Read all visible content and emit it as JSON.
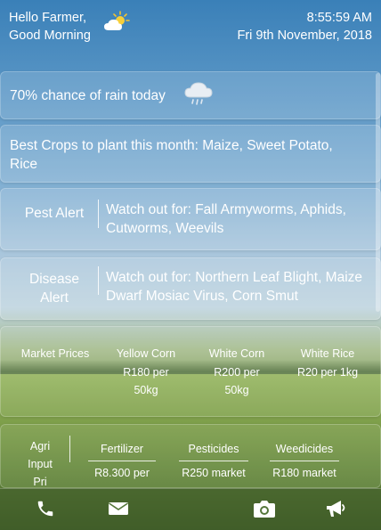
{
  "header": {
    "greeting_line1": "Hello Farmer,",
    "greeting_line2": "Good Morning",
    "weather_icon": "partly-sunny-icon",
    "time": "8:55:59 AM",
    "date": "Fri 9th November, 2018"
  },
  "rain": {
    "text": "70% chance of rain today",
    "icon": "rain-cloud-icon"
  },
  "crops": {
    "text": "Best Crops to plant this month: Maize, Sweet Potato, Rice"
  },
  "pest_alert": {
    "label": "Pest Alert",
    "text": "Watch out for: Fall Armyworms, Aphids, Cutworms, Weevils"
  },
  "disease_alert": {
    "label_line1": "Disease",
    "label_line2": "Alert",
    "text": "Watch out for: Northern Leaf Blight, Maize Dwarf Mosiac Virus, Corn Smut"
  },
  "market_prices": {
    "label": "Market Prices",
    "items": [
      {
        "name": "Yellow Corn",
        "price_line1": "R180 per",
        "price_line2": "50kg"
      },
      {
        "name": "White Corn",
        "price_line1": "R200 per",
        "price_line2": "50kg"
      },
      {
        "name": "White Rice",
        "price_line1": "R20 per 1kg"
      }
    ]
  },
  "agri_input": {
    "label_line1": "Agri",
    "label_line2": "Input",
    "label_line3": "Pri",
    "items": [
      {
        "name": "Fertilizer",
        "value": "R8.300 per"
      },
      {
        "name": "Pesticides",
        "value": "R250 market"
      },
      {
        "name": "Weedicides",
        "value": "R180 market"
      }
    ]
  },
  "nav": {
    "items": [
      "phone-icon",
      "mail-icon",
      "camera-icon",
      "megaphone-icon"
    ]
  }
}
